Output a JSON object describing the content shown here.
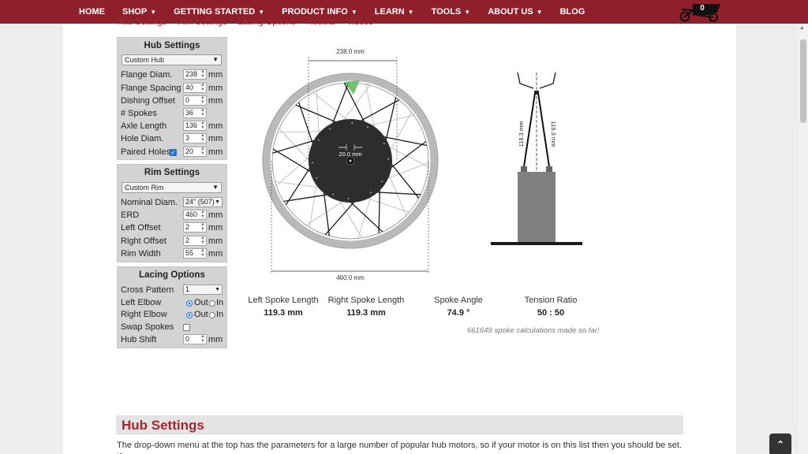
{
  "nav": {
    "items": [
      {
        "label": "HOME",
        "chevron": false
      },
      {
        "label": "SHOP",
        "chevron": true
      },
      {
        "label": "GETTING STARTED",
        "chevron": true
      },
      {
        "label": "PRODUCT INFO",
        "chevron": true
      },
      {
        "label": "LEARN",
        "chevron": true
      },
      {
        "label": "TOOLS",
        "chevron": true
      },
      {
        "label": "ABOUT US",
        "chevron": true
      },
      {
        "label": "BLOG",
        "chevron": false
      }
    ],
    "cart_count": "0",
    "cart_icon": "cargo-bike-cart-icon"
  },
  "subtabs": [
    "Hub Settings",
    "Rim Settings",
    "Lacing Options",
    "Results",
    "Videos"
  ],
  "hub_panel": {
    "title": "Hub Settings",
    "preset": "Custom Hub",
    "flange_diam": {
      "label": "Flange Diam.",
      "value": "238",
      "unit": "mm"
    },
    "flange_spacing": {
      "label": "Flange Spacing",
      "value": "40",
      "unit": "mm"
    },
    "dishing_offset": {
      "label": "Dishing Offset",
      "value": "0",
      "unit": "mm"
    },
    "spokes": {
      "label": "# Spokes",
      "value": "36"
    },
    "axle_length": {
      "label": "Axle Length",
      "value": "136",
      "unit": "mm"
    },
    "hole_diam": {
      "label": "Hole Diam.",
      "value": "3",
      "unit": "mm"
    },
    "paired_holes": {
      "label": "Paired Holes",
      "checked": true,
      "value": "20",
      "unit": "mm"
    }
  },
  "rim_panel": {
    "title": "Rim Settings",
    "preset": "Custom Rim",
    "nominal_diam": {
      "label": "Nominal Diam.",
      "value": "24\" (507)"
    },
    "erd": {
      "label": "ERD",
      "value": "460",
      "unit": "mm"
    },
    "left_offset": {
      "label": "Left Offset",
      "value": "2",
      "unit": "mm"
    },
    "right_offset": {
      "label": "Right Offset",
      "value": "2",
      "unit": "mm"
    },
    "rim_width": {
      "label": "Rim Width",
      "value": "55",
      "unit": "mm"
    }
  },
  "lacing_panel": {
    "title": "Lacing Options",
    "cross_pattern": {
      "label": "Cross Pattern",
      "value": "1"
    },
    "left_elbow": {
      "label": "Left Elbow",
      "out": "Out",
      "in": "In",
      "selected": "Out"
    },
    "right_elbow": {
      "label": "Right Elbow",
      "out": "Out",
      "in": "In",
      "selected": "Out"
    },
    "swap_spokes": {
      "label": "Swap Spokes",
      "checked": false
    },
    "hub_shift": {
      "label": "Hub Shift",
      "value": "0",
      "unit": "mm"
    }
  },
  "wheel": {
    "flange_dim_label": "238.0 mm",
    "erd_dim_label": "460.0 mm",
    "spacing_dim_label": "20.0 mm",
    "colors": {
      "rim": "#b9b9b9",
      "hub": "#2d2d2d",
      "spoke": "#1a1a1a",
      "highlight": "#5cb85c"
    }
  },
  "side_view": {
    "left_spoke_label": "119.3 mm",
    "right_spoke_label": "119.3 mm"
  },
  "results": {
    "left_spoke": {
      "label": "Left Spoke Length",
      "value": "119.3 mm"
    },
    "right_spoke": {
      "label": "Right Spoke Length",
      "value": "119.3 mm"
    },
    "spoke_angle": {
      "label": "Spoke Angle",
      "value": "74.9 °"
    },
    "tension_ratio": {
      "label": "Tension Ratio",
      "value": "50 : 50"
    },
    "calc_count": "661649 spoke calculations made so far!"
  },
  "section": {
    "title": "Hub Settings",
    "text": "The drop-down menu at the top has the parameters for a large number of popular hub motors, so if your motor is on this list then you should be set. If"
  },
  "colors": {
    "brand": "#8f1f2a",
    "link": "#a3262e",
    "panel": "#d3d3d3"
  }
}
